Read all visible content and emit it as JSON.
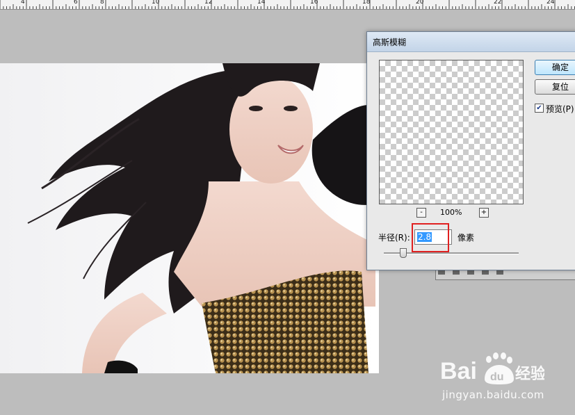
{
  "ruler": {
    "numbers": [
      "4",
      "6",
      "8",
      "10",
      "12",
      "14",
      "16",
      "18",
      "20",
      "22",
      "24"
    ]
  },
  "dialog": {
    "title": "高斯模糊",
    "ok_label": "确定",
    "reset_label": "复位",
    "preview_checked": true,
    "preview_label": "预览(P)",
    "zoom_out": "-",
    "zoom_in": "+",
    "zoom_level": "100%",
    "radius_label": "半径(R):",
    "radius_value": "2.8",
    "unit_label": "像素",
    "slider_level": 0.12
  },
  "watermark": {
    "logo_text": "Bai du 经验",
    "url": "jingyan.baidu.com"
  },
  "colors": {
    "canvas_gray": "#bdbdbd",
    "highlight_red": "#e02020",
    "selection_blue": "#3399ff"
  }
}
